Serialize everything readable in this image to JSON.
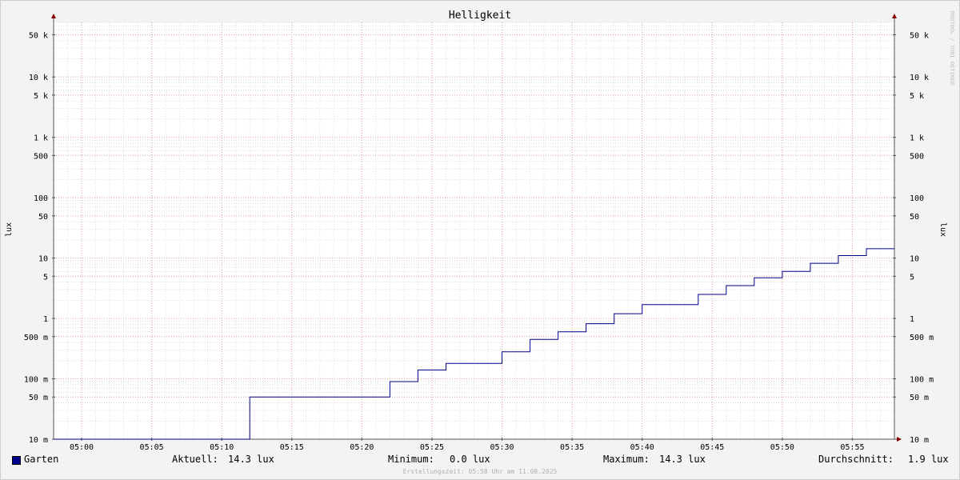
{
  "chart_data": {
    "type": "line",
    "title": "Helligkeit",
    "ylabel": "lux",
    "watermark": "RRDTOOL / TOBI OETIKER",
    "y_scale": "log",
    "ylim": [
      10,
      80000
    ],
    "x_ticks": [
      "05:00",
      "05:05",
      "05:10",
      "05:15",
      "05:20",
      "05:25",
      "05:30",
      "05:35",
      "05:40",
      "05:45",
      "05:50",
      "05:55"
    ],
    "y_ticks": [
      {
        "label": "50 k",
        "value": 50000
      },
      {
        "label": "10 k",
        "value": 10000
      },
      {
        "label": "5 k",
        "value": 5000
      },
      {
        "label": "1 k",
        "value": 1000
      },
      {
        "label": "500",
        "value": 500
      },
      {
        "label": "100",
        "value": 100
      },
      {
        "label": "50",
        "value": 50
      },
      {
        "label": "10",
        "value": 10
      },
      {
        "label": "5",
        "value": 5
      },
      {
        "label": "1",
        "value": 1
      },
      {
        "label": "500 m",
        "value": 0.5
      },
      {
        "label": "100 m",
        "value": 0.1
      },
      {
        "label": "50 m",
        "value": 0.05
      },
      {
        "label": "10 m",
        "value": 0.01
      }
    ],
    "series": [
      {
        "name": "Garten",
        "color": "#00008b",
        "points": [
          [
            "04:58",
            0.01
          ],
          [
            "05:12",
            0.01
          ],
          [
            "05:12",
            0.05
          ],
          [
            "05:22",
            0.05
          ],
          [
            "05:22",
            0.09
          ],
          [
            "05:24",
            0.09
          ],
          [
            "05:24",
            0.14
          ],
          [
            "05:26",
            0.14
          ],
          [
            "05:26",
            0.18
          ],
          [
            "05:30",
            0.18
          ],
          [
            "05:30",
            0.28
          ],
          [
            "05:32",
            0.28
          ],
          [
            "05:32",
            0.45
          ],
          [
            "05:34",
            0.45
          ],
          [
            "05:34",
            0.6
          ],
          [
            "05:36",
            0.6
          ],
          [
            "05:36",
            0.82
          ],
          [
            "05:38",
            0.82
          ],
          [
            "05:38",
            1.2
          ],
          [
            "05:40",
            1.2
          ],
          [
            "05:40",
            1.7
          ],
          [
            "05:44",
            1.7
          ],
          [
            "05:44",
            2.5
          ],
          [
            "05:46",
            2.5
          ],
          [
            "05:46",
            3.5
          ],
          [
            "05:48",
            3.5
          ],
          [
            "05:48",
            4.7
          ],
          [
            "05:50",
            4.7
          ],
          [
            "05:50",
            6.0
          ],
          [
            "05:52",
            6.0
          ],
          [
            "05:52",
            8.2
          ],
          [
            "05:54",
            8.2
          ],
          [
            "05:54",
            11.0
          ],
          [
            "05:56",
            11.0
          ],
          [
            "05:56",
            14.3
          ],
          [
            "05:58",
            14.3
          ]
        ]
      }
    ],
    "grid": true
  },
  "legend": {
    "series_name": "Garten",
    "current_label": "Aktuell:",
    "current_value": "14.3 lux",
    "min_label": "Minimum:",
    "min_value": "0.0 lux",
    "max_label": "Maximum:",
    "max_value": "14.3 lux",
    "avg_label": "Durchschnitt:",
    "avg_value": "1.9 lux"
  },
  "footer": "Erstellungszeit: 05:58 Uhr am 11.08.2025"
}
